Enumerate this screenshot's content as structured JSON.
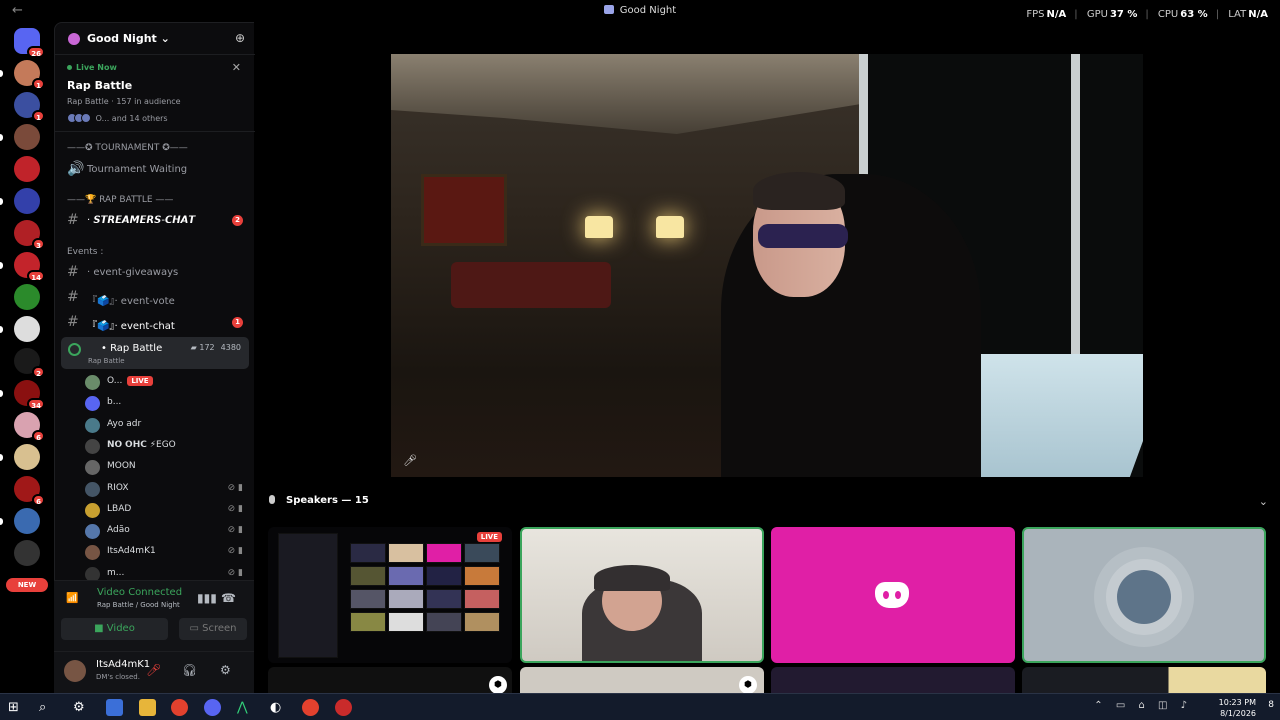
{
  "window": {
    "title": "Good Night",
    "back": "←"
  },
  "stats": {
    "fps_label": "FPS",
    "fps": "N/A",
    "gpu_label": "GPU",
    "gpu": "37 %",
    "cpu_label": "CPU",
    "cpu": "63 %",
    "lat_label": "LAT",
    "lat": "N/A"
  },
  "rail": {
    "home_badge": "26",
    "new_label": "NEW",
    "badges": [
      "1",
      "1",
      "",
      "",
      "",
      "3",
      "14",
      "",
      "",
      "2",
      "34",
      "6",
      "",
      "6",
      "",
      "",
      ""
    ]
  },
  "guild": {
    "name": "Good Night",
    "chevron": "⌄"
  },
  "live_now": {
    "label": "Live Now",
    "title": "Rap Battle",
    "sub": "Rap Battle · 157 in audience",
    "others": "O... and 14 others"
  },
  "categories": {
    "tournament": "——✪ TOURNAMENT ✪——",
    "tournament_waiting": "Tournament Waiting",
    "rap_battle": "——🏆 RAP BATTLE ——",
    "events": "Events :"
  },
  "channels": [
    {
      "name": "· 𝙎𝙏𝙍𝙀𝘼𝙈𝙀𝙍𝙎-𝘾𝙃𝘼𝙏",
      "badge": "2"
    },
    {
      "name": "· event-giveaways",
      "badge": ""
    },
    {
      "name": "『🗳️』· event-vote",
      "badge": ""
    },
    {
      "name": "『🗳️』· event-chat",
      "badge": "1"
    }
  ],
  "voice_channel": {
    "name": "• Rap Battle",
    "sub": "Rap Battle",
    "viewers": "172",
    "count": "4380"
  },
  "voice_users": [
    {
      "name": "O...",
      "live": "LIVE"
    },
    {
      "name": "b...",
      "live": ""
    },
    {
      "name": "Ayo adr",
      "live": ""
    },
    {
      "name": "𝗡𝗢 𝗢𝗛𝗖 ⚡EGO",
      "live": ""
    },
    {
      "name": "MOON",
      "live": ""
    },
    {
      "name": "RIOX",
      "live": ""
    },
    {
      "name": "LBAD",
      "live": ""
    },
    {
      "name": "Adão",
      "live": ""
    },
    {
      "name": "ItsAd4mK1",
      "live": ""
    },
    {
      "name": "m...",
      "live": ""
    }
  ],
  "panel": {
    "connected": "Video Connected",
    "location": "Rap Battle / Good Night",
    "video_btn": "Video",
    "screen_btn": "Screen"
  },
  "user": {
    "name": "ItsAd4mK1",
    "status": "DM's closed."
  },
  "stage": {
    "speakers_label": "Speakers — 15",
    "tile_live": "LIVE"
  },
  "taskbar": {
    "time": "10:23 PM",
    "date": "8/1/2026",
    "notifications": "8"
  },
  "colors": {
    "accent_green": "#3ba55c",
    "badge_red": "#e8403b",
    "discord_pink": "#e01fa6"
  }
}
